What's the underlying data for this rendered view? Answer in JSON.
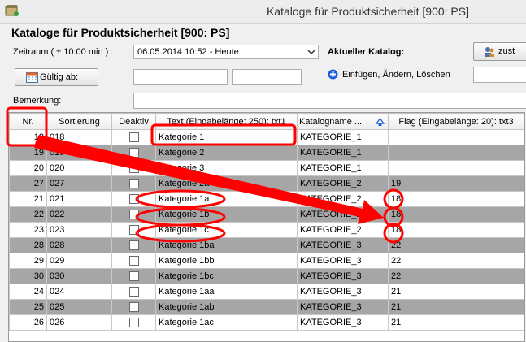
{
  "window": {
    "title": "Kataloge für Produktsicherheit [900: PS]"
  },
  "heading": "Kataloge für Produktsicherheit [900: PS]",
  "zeitraum": {
    "label": "Zeitraum ( ± 10:00 min ) :",
    "value": "06.05.2014 10:52 - Heute"
  },
  "catalog": {
    "label": "Aktueller Katalog:",
    "button_label": "zust"
  },
  "gueltig": {
    "button_label": "Gültig ab:"
  },
  "insert_link": "Einfügen, Ändern, Löschen",
  "bemerkung_label": "Bemerkung:",
  "columns": [
    "Nr.",
    "Sortierung",
    "Deaktiv",
    "Text (Eingabelänge: 250): txt1",
    "Katalogname ...",
    "Flag (Eingabelänge: 20): txt3"
  ],
  "rows": [
    {
      "nr": "18",
      "sort": "018",
      "text": "Kategorie 1",
      "katalog": "KATEGORIE_1",
      "flag": ""
    },
    {
      "nr": "19",
      "sort": "019",
      "text": "Kategorie 2",
      "katalog": "KATEGORIE_1",
      "flag": ""
    },
    {
      "nr": "20",
      "sort": "020",
      "text": "Kategorie 3",
      "katalog": "KATEGORIE_1",
      "flag": ""
    },
    {
      "nr": "27",
      "sort": "027",
      "text": "Kategorie 2a",
      "katalog": "KATEGORIE_2",
      "flag": "19"
    },
    {
      "nr": "21",
      "sort": "021",
      "text": "Kategorie 1a",
      "katalog": "KATEGORIE_2",
      "flag": "18"
    },
    {
      "nr": "22",
      "sort": "022",
      "text": "Kategorie 1b",
      "katalog": "KATEGORIE_2",
      "flag": "18"
    },
    {
      "nr": "23",
      "sort": "023",
      "text": "Kategorie 1c",
      "katalog": "KATEGORIE_2",
      "flag": "18"
    },
    {
      "nr": "28",
      "sort": "028",
      "text": "Kategorie 1ba",
      "katalog": "KATEGORIE_3",
      "flag": "22"
    },
    {
      "nr": "29",
      "sort": "029",
      "text": "Kategorie 1bb",
      "katalog": "KATEGORIE_3",
      "flag": "22"
    },
    {
      "nr": "30",
      "sort": "030",
      "text": "Kategorie 1bc",
      "katalog": "KATEGORIE_3",
      "flag": "22"
    },
    {
      "nr": "24",
      "sort": "024",
      "text": "Kategorie 1aa",
      "katalog": "KATEGORIE_3",
      "flag": "21"
    },
    {
      "nr": "25",
      "sort": "025",
      "text": "Kategorie 1ab",
      "katalog": "KATEGORIE_3",
      "flag": "21"
    },
    {
      "nr": "26",
      "sort": "026",
      "text": "Kategorie 1ac",
      "katalog": "KATEGORIE_3",
      "flag": "21"
    }
  ],
  "colors": {
    "row_alt": "#a6a6a6",
    "annotation": "#ff0000"
  }
}
